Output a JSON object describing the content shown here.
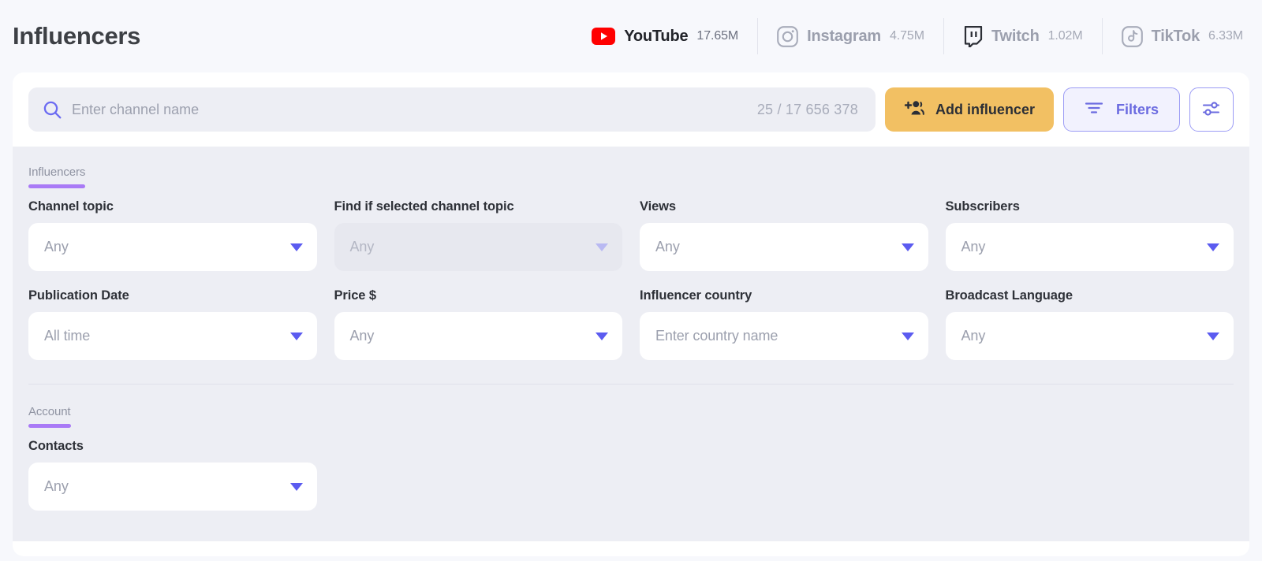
{
  "header": {
    "title": "Influencers",
    "platforms": [
      {
        "name": "YouTube",
        "count": "17.65M",
        "icon": "youtube-icon",
        "active": true
      },
      {
        "name": "Instagram",
        "count": "4.75M",
        "icon": "instagram-icon",
        "active": false
      },
      {
        "name": "Twitch",
        "count": "1.02M",
        "icon": "twitch-icon",
        "active": false
      },
      {
        "name": "TikTok",
        "count": "6.33M",
        "icon": "tiktok-icon",
        "active": false
      }
    ]
  },
  "search": {
    "placeholder": "Enter channel name",
    "value": "",
    "counter": "25 / 17 656 378",
    "icon": "search-icon"
  },
  "toolbar": {
    "add_influencer_label": "Add influencer",
    "add_influencer_icon": "add-user-icon",
    "filters_label": "Filters",
    "filters_icon": "filter-lines-icon",
    "settings_icon": "sliders-icon"
  },
  "sections": [
    {
      "id": "influencers",
      "label": "Influencers"
    },
    {
      "id": "account",
      "label": "Account"
    }
  ],
  "influencer_fields": [
    {
      "label": "Channel topic",
      "value": "Any",
      "disabled": false
    },
    {
      "label": "Find if selected channel topic",
      "value": "Any",
      "disabled": true
    },
    {
      "label": "Views",
      "value": "Any",
      "disabled": false
    },
    {
      "label": "Subscribers",
      "value": "Any",
      "disabled": false
    },
    {
      "label": "Publication Date",
      "value": "All time",
      "disabled": false
    },
    {
      "label": "Price $",
      "value": "Any",
      "disabled": false
    },
    {
      "label": "Influencer country",
      "value": "Enter country name",
      "disabled": false
    },
    {
      "label": "Broadcast Language",
      "value": "Any",
      "disabled": false
    }
  ],
  "account_fields": [
    {
      "label": "Contacts",
      "value": "Any",
      "disabled": false
    }
  ],
  "colors": {
    "accent_purple": "#5b5bf0",
    "tab_underline": "#a97af6",
    "amber_button": "#f2c063",
    "youtube_red": "#ff0000",
    "page_bg": "#f7f8fc",
    "panel_bg": "#edeef4"
  }
}
